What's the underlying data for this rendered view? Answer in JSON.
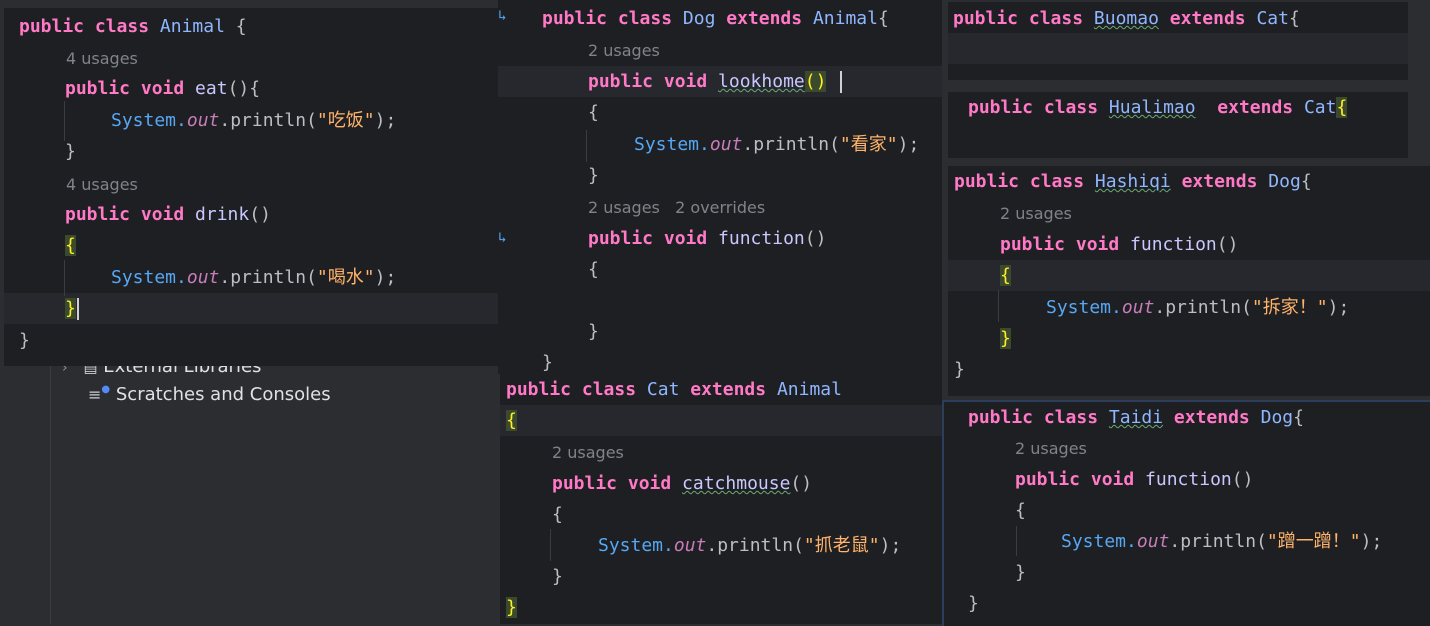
{
  "animal": {
    "l1": {
      "kw": "public class ",
      "name": "Animal",
      "rest": " {"
    },
    "u1": "4 usages",
    "l2": {
      "kw": "public void ",
      "name": "eat",
      "rest": "(){"
    },
    "l3": {
      "a": "System.",
      "b": "out",
      "c": ".println(",
      "s": "\"吃饭\"",
      "d": ");"
    },
    "l4": "}",
    "u2": "4 usages",
    "l5": {
      "kw": "public void ",
      "name": "drink",
      "rest": "()"
    },
    "l6": "{",
    "l7": {
      "a": "System.",
      "b": "out",
      "c": ".println(",
      "s": "\"喝水\"",
      "d": ");"
    },
    "l8": "}",
    "l9": "}"
  },
  "tree": {
    "external": "External Libraries",
    "scratches": "Scratches and Consoles"
  },
  "dog": {
    "l1": {
      "kw": "public class ",
      "name": "Dog",
      "kw2": " extends ",
      "parent": "Animal",
      "rest": "{"
    },
    "u1": "2 usages",
    "l2": {
      "kw": "public void ",
      "name": "lookhome",
      "rest": "()"
    },
    "l3": "{",
    "l4": {
      "a": "System.",
      "b": "out",
      "c": ".println(",
      "s": "\"看家\"",
      "d": ");"
    },
    "l5": "}",
    "u2": "2 usages   2 overrides",
    "l6": {
      "kw": "public void ",
      "name": "function",
      "rest": "()"
    },
    "l7": "{",
    "l8": "}",
    "l9": "}"
  },
  "cat": {
    "l1": {
      "kw": "public class ",
      "name": "Cat",
      "kw2": " extends ",
      "parent": "Animal"
    },
    "l2": "{",
    "u1": "2 usages",
    "l3": {
      "kw": "public void ",
      "name": "catchmouse",
      "rest": "()"
    },
    "l4": "{",
    "l5": {
      "a": "System.",
      "b": "out",
      "c": ".println(",
      "s": "\"抓老鼠\"",
      "d": ");"
    },
    "l6": "}",
    "l7": "}"
  },
  "buomao": {
    "l1": {
      "kw": "public class ",
      "name": "Buomao",
      "kw2": " extends ",
      "parent": "Cat",
      "rest": "{"
    }
  },
  "hualimao": {
    "l1": {
      "kw": "public class ",
      "name": "Hualimao",
      "kw2": "  extends ",
      "parent": "Cat",
      "rest": "{"
    }
  },
  "hashiqi": {
    "l1": {
      "kw": "public class ",
      "name": "Hashiqi",
      "kw2": " extends ",
      "parent": "Dog",
      "rest": "{"
    },
    "u1": "2 usages",
    "l2": {
      "kw": "public void ",
      "name": "function",
      "rest": "()"
    },
    "l3": "{",
    "l4": {
      "a": "System.",
      "b": "out",
      "c": ".println(",
      "s": "\"拆家！\"",
      "d": ");"
    },
    "l5": "}",
    "l6": "}"
  },
  "taidi": {
    "l1": {
      "kw": "public class ",
      "name": "Taidi",
      "kw2": " extends ",
      "parent": "Dog",
      "rest": "{"
    },
    "u1": "2 usages",
    "l2": {
      "kw": "public void ",
      "name": "function",
      "rest": "()"
    },
    "l3": "{",
    "l4": {
      "a": "System.",
      "b": "out",
      "c": ".println(",
      "s": "\"蹭一蹭！\"",
      "d": ");"
    },
    "l5": "}",
    "l6": "}"
  },
  "colors": {
    "editor_bg": "#1e1f22",
    "keyword": "#ff79c6",
    "class_name": "#8fb7ff",
    "string": "#ffb36b",
    "static_field": "#c77dbb",
    "usage_hint": "#7f838a"
  }
}
